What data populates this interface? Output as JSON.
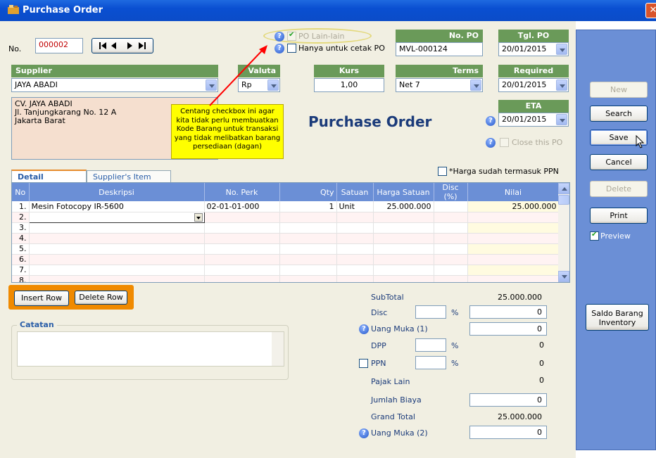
{
  "window": {
    "title": "Purchase Order"
  },
  "header": {
    "no_label": "No.",
    "no_value": "000002",
    "po_lain_label": "PO Lain-lain",
    "cetak_label": "Hanya untuk cetak PO",
    "no_po_header": "No. PO",
    "no_po_value": "MVL-000124",
    "tgl_po_header": "Tgl. PO",
    "tgl_po_value": "20/01/2015",
    "supplier_header": "Supplier",
    "supplier_value": "JAYA ABADI",
    "valuta_header": "Valuta",
    "valuta_value": "Rp",
    "kurs_header": "Kurs",
    "kurs_value": "1,00",
    "terms_header": "Terms",
    "terms_value": "Net 7",
    "required_header": "Required",
    "required_value": "20/01/2015",
    "eta_header": "ETA",
    "eta_value": "20/01/2015",
    "close_po_label": "Close this PO",
    "address_lines": [
      "CV. JAYA ABADI",
      "Jl. Tanjungkarang No. 12 A",
      "Jakarta Barat"
    ],
    "big_title": "Purchase Order",
    "ppn_note": "*Harga sudah termasuk PPN"
  },
  "note": {
    "text": "Centang checkbox ini agar kita tidak perlu membuatkan Kode Barang untuk transaksi yang tidak melibatkan barang persediaan (dagan)"
  },
  "tabs": [
    {
      "label": "Detail Transaksi",
      "active": true
    },
    {
      "label": "Supplier's Item No.",
      "active": false
    }
  ],
  "grid": {
    "columns": [
      "No",
      "Deskripsi",
      "No. Perk",
      "Qty",
      "Satuan",
      "Harga Satuan",
      "Disc (%)",
      "Nilai"
    ],
    "rows": [
      {
        "no": "1.",
        "desc": "Mesin Fotocopy IR-5600",
        "perk": "02-01-01-000",
        "qty": "1",
        "satuan": "Unit",
        "harga": "25.000.000",
        "disc": "",
        "nilai": "25.000.000"
      },
      {
        "no": "2.",
        "desc": "",
        "perk": "",
        "qty": "",
        "satuan": "",
        "harga": "",
        "disc": "",
        "nilai": ""
      },
      {
        "no": "3.",
        "desc": "",
        "perk": "",
        "qty": "",
        "satuan": "",
        "harga": "",
        "disc": "",
        "nilai": ""
      },
      {
        "no": "4.",
        "desc": "",
        "perk": "",
        "qty": "",
        "satuan": "",
        "harga": "",
        "disc": "",
        "nilai": ""
      },
      {
        "no": "5.",
        "desc": "",
        "perk": "",
        "qty": "",
        "satuan": "",
        "harga": "",
        "disc": "",
        "nilai": ""
      },
      {
        "no": "6.",
        "desc": "",
        "perk": "",
        "qty": "",
        "satuan": "",
        "harga": "",
        "disc": "",
        "nilai": ""
      },
      {
        "no": "7.",
        "desc": "",
        "perk": "",
        "qty": "",
        "satuan": "",
        "harga": "",
        "disc": "",
        "nilai": ""
      },
      {
        "no": "8.",
        "desc": "",
        "perk": "",
        "qty": "",
        "satuan": "",
        "harga": "",
        "disc": "",
        "nilai": ""
      }
    ]
  },
  "row_buttons": {
    "insert": "Insert Row",
    "delete": "Delete Row"
  },
  "catatan": {
    "label": "Catatan",
    "value": ""
  },
  "summary": {
    "subtotal_label": "SubTotal",
    "subtotal_value": "25.000.000",
    "disc_label": "Disc",
    "disc_value": "0",
    "pct": "%",
    "uang_muka1_label": "Uang Muka (1)",
    "uang_muka1_value": "0",
    "dpp_label": "DPP",
    "dpp_value": "0",
    "ppn_label": "PPN",
    "ppn_value": "0",
    "pajak_label": "Pajak Lain",
    "pajak_value": "0",
    "biaya_label": "Jumlah Biaya",
    "biaya_value": "0",
    "grand_label": "Grand Total",
    "grand_value": "25.000.000",
    "uang_muka2_label": "Uang Muka (2)",
    "uang_muka2_value": "0"
  },
  "side": {
    "new": "New",
    "search": "Search",
    "save": "Save",
    "cancel": "Cancel",
    "delete": "Delete",
    "print": "Print",
    "preview": "Preview",
    "saldo_line1": "Saldo Barang",
    "saldo_line2": "Inventory"
  },
  "colors": {
    "title_bar": "#0a4fd1",
    "header_green": "#6a9a59",
    "side_panel": "#6b8fd6",
    "note_bg": "#ffff00",
    "no_red": "#c00000",
    "highlight_orange": "#f08a00"
  }
}
